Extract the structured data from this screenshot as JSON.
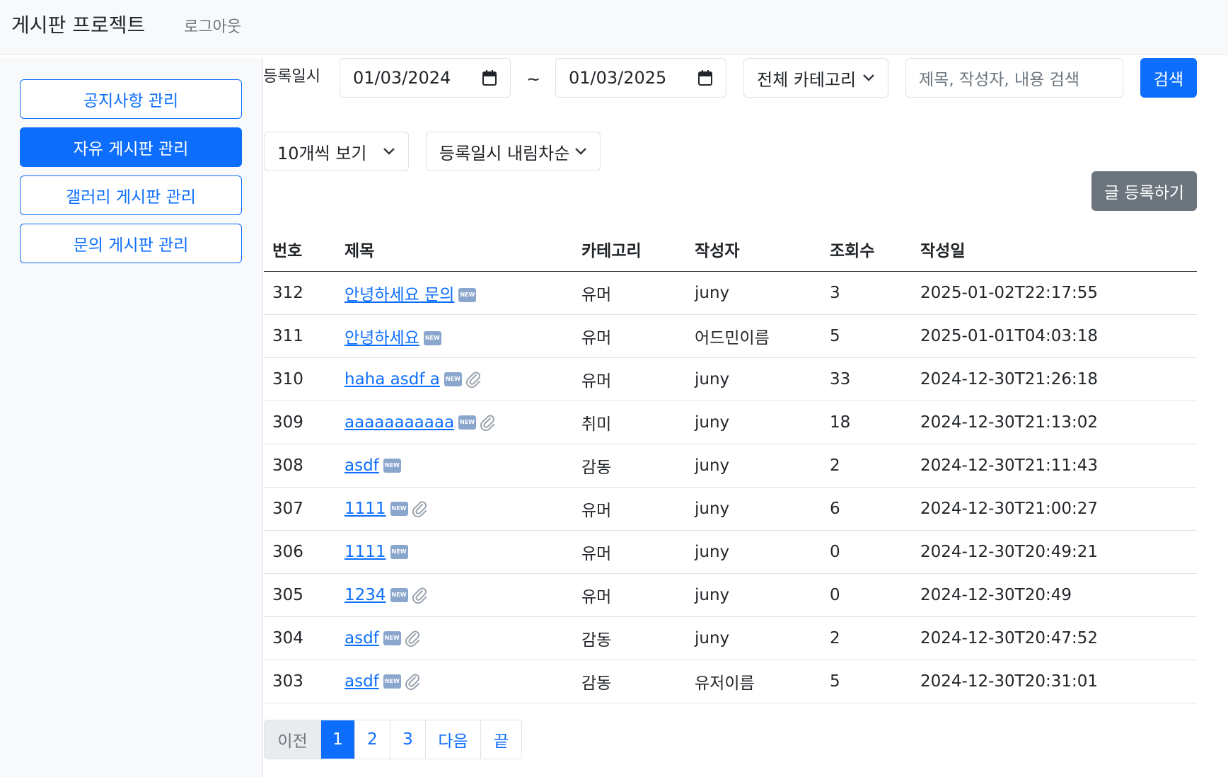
{
  "header": {
    "brand": "게시판 프로젝트",
    "logout": "로그아웃"
  },
  "sidebar": {
    "items": [
      {
        "label": "공지사항 관리",
        "active": false
      },
      {
        "label": "자유 게시판 관리",
        "active": true
      },
      {
        "label": "갤러리 게시판 관리",
        "active": false
      },
      {
        "label": "문의 게시판 관리",
        "active": false
      }
    ]
  },
  "filters": {
    "date_label": "등록일시",
    "start_date": "01/03/2024",
    "tilde": "~",
    "end_date": "01/03/2025",
    "category": "전체 카테고리",
    "search_placeholder": "제목, 작성자, 내용 검색",
    "search_button": "검색",
    "page_size": "10개씩 보기",
    "sort": "등록일시 내림차순",
    "write_button": "글 등록하기"
  },
  "table": {
    "headers": [
      "번호",
      "제목",
      "카테고리",
      "작성자",
      "조회수",
      "작성일"
    ],
    "rows": [
      {
        "no": "312",
        "title": "안녕하세요 문의",
        "attach": false,
        "category": "유머",
        "author": "juny",
        "views": "3",
        "date": "2025-01-02T22:17:55"
      },
      {
        "no": "311",
        "title": "안녕하세요",
        "attach": false,
        "category": "유머",
        "author": "어드민이름",
        "views": "5",
        "date": "2025-01-01T04:03:18"
      },
      {
        "no": "310",
        "title": "haha asdf a",
        "attach": true,
        "category": "유머",
        "author": "juny",
        "views": "33",
        "date": "2024-12-30T21:26:18"
      },
      {
        "no": "309",
        "title": "aaaaaaaaaaa",
        "attach": true,
        "category": "취미",
        "author": "juny",
        "views": "18",
        "date": "2024-12-30T21:13:02"
      },
      {
        "no": "308",
        "title": "asdf",
        "attach": false,
        "category": "감동",
        "author": "juny",
        "views": "2",
        "date": "2024-12-30T21:11:43"
      },
      {
        "no": "307",
        "title": "1111",
        "attach": true,
        "category": "유머",
        "author": "juny",
        "views": "6",
        "date": "2024-12-30T21:00:27"
      },
      {
        "no": "306",
        "title": "1111",
        "attach": false,
        "category": "유머",
        "author": "juny",
        "views": "0",
        "date": "2024-12-30T20:49:21"
      },
      {
        "no": "305",
        "title": "1234",
        "attach": true,
        "category": "유머",
        "author": "juny",
        "views": "0",
        "date": "2024-12-30T20:49"
      },
      {
        "no": "304",
        "title": "asdf",
        "attach": true,
        "category": "감동",
        "author": "juny",
        "views": "2",
        "date": "2024-12-30T20:47:52"
      },
      {
        "no": "303",
        "title": "asdf",
        "attach": true,
        "category": "감동",
        "author": "유저이름",
        "views": "5",
        "date": "2024-12-30T20:31:01"
      }
    ]
  },
  "icons": {
    "new_badge": "NEW",
    "attachment": "paperclip-icon",
    "calendar": "calendar-icon",
    "dropdown": "chevron-down-icon"
  },
  "colors": {
    "primary": "#0d6efd",
    "secondary": "#6c757d",
    "sidebar_bg": "#f8f9fa"
  },
  "pagination": {
    "prev": "이전",
    "pages": [
      "1",
      "2",
      "3"
    ],
    "current": "1",
    "next": "다음",
    "last": "끝"
  }
}
